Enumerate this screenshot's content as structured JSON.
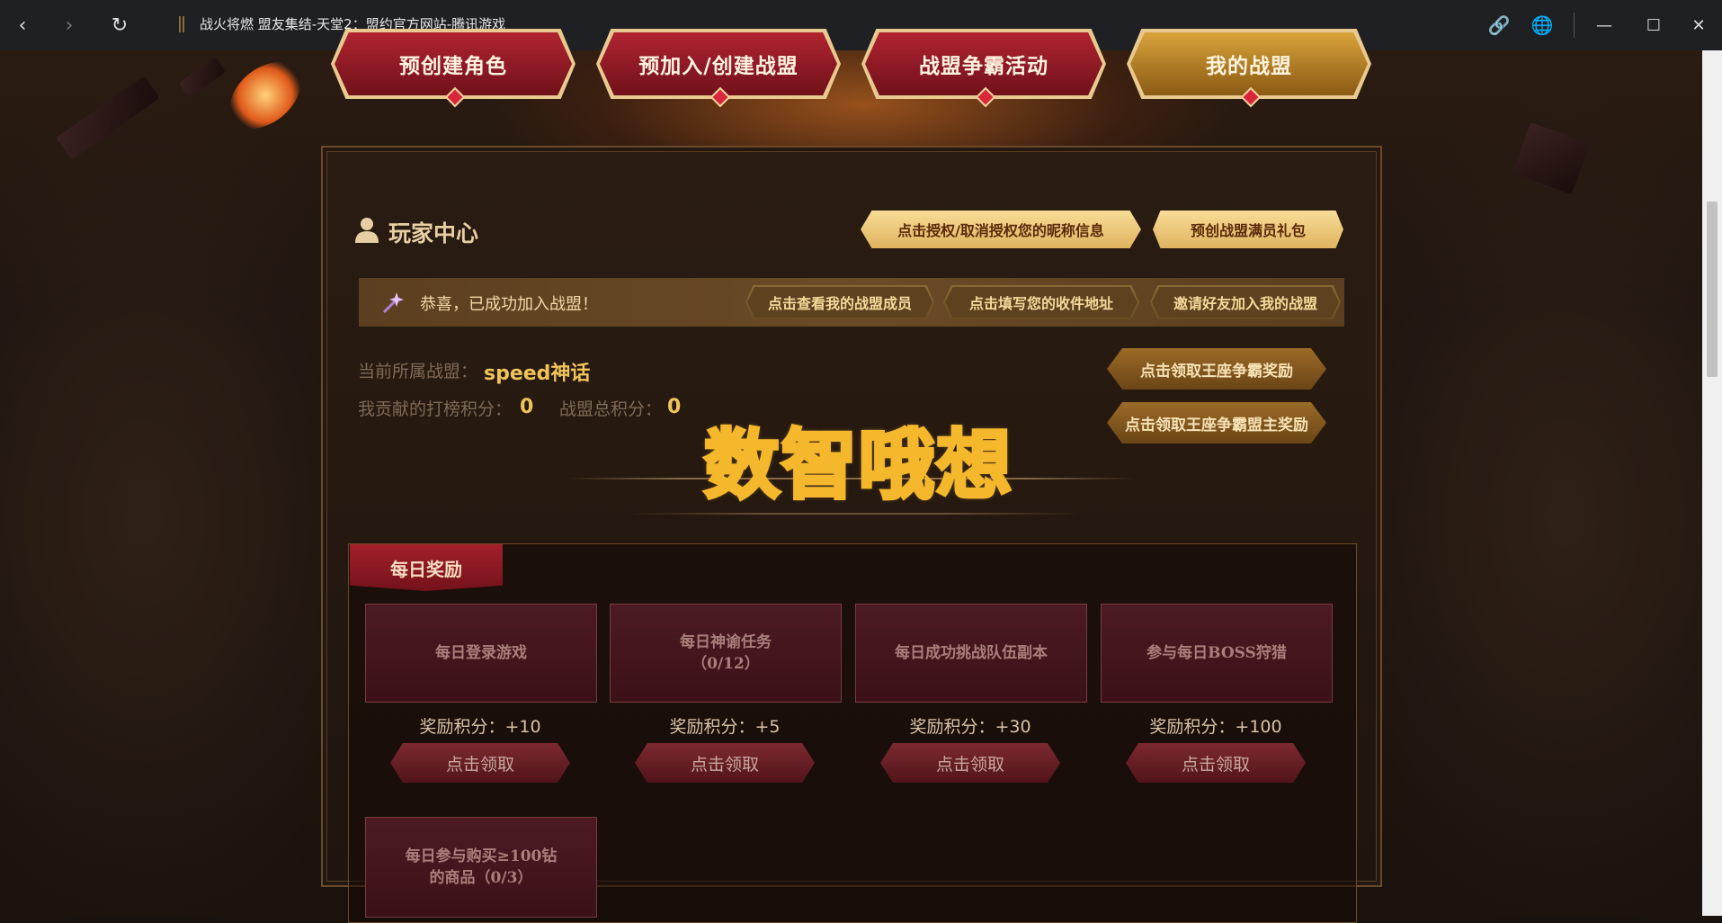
{
  "browser": {
    "tab_title": "战火将燃 盟友集结-天堂2：盟约官方网站-腾讯游戏",
    "back_icon": "‹",
    "forward_icon": "›",
    "reload_icon": "↻",
    "link_icon": "🔗",
    "globe_icon": "🌐",
    "minimize_icon": "—",
    "maximize_icon": "☐",
    "close_icon": "✕"
  },
  "topnav": [
    {
      "label": "预创建角色"
    },
    {
      "label": "预加入/创建战盟"
    },
    {
      "label": "战盟争霸活动"
    },
    {
      "label": "我的战盟"
    }
  ],
  "player_center": {
    "title": "玩家中心",
    "auth_button": "点击授权/取消授权您的昵称信息",
    "gift_button": "预创战盟满员礼包"
  },
  "notice": {
    "text": "恭喜，已成功加入战盟！",
    "buttons": [
      "点击查看我的战盟成员",
      "点击填写您的收件地址",
      "邀请好友加入我的战盟"
    ]
  },
  "info": {
    "alliance_label": "当前所属战盟：",
    "alliance_value": "speed神话",
    "contrib_label": "我贡献的打榜积分：",
    "contrib_value": "0",
    "total_label": "战盟总积分：",
    "total_value": "0",
    "claim_throne": "点击领取王座争霸奖励",
    "claim_throne_leader": "点击领取王座争霸盟主奖励"
  },
  "watermark": "数智哦想",
  "daily": {
    "tab": "每日奖励",
    "tasks": [
      {
        "name": "每日登录游戏",
        "reward_label": "奖励积分：",
        "reward": "+10",
        "claim": "点击领取"
      },
      {
        "name": "每日神谕任务\n（0/12）",
        "reward_label": "奖励积分：",
        "reward": "+5",
        "claim": "点击领取"
      },
      {
        "name": "每日成功挑战队伍副本",
        "reward_label": "奖励积分：",
        "reward": "+30",
        "claim": "点击领取"
      },
      {
        "name": "参与每日BOSS狩猎",
        "reward_label": "奖励积分：",
        "reward": "+100",
        "claim": "点击领取"
      },
      {
        "name": "每日参与购买≥100钻\n的商品（0/3）"
      }
    ]
  }
}
